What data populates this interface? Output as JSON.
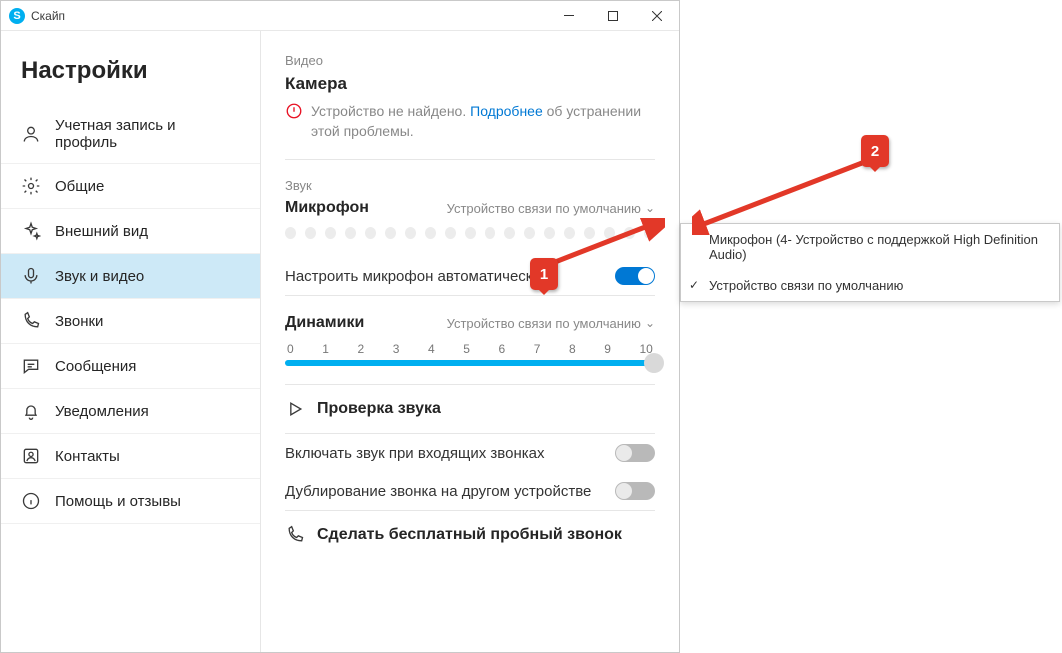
{
  "titlebar": {
    "app_name": "Скайп",
    "app_glyph": "S"
  },
  "sidebar": {
    "title": "Настройки",
    "items": [
      {
        "label": "Учетная запись и профиль"
      },
      {
        "label": "Общие"
      },
      {
        "label": "Внешний вид"
      },
      {
        "label": "Звук и видео"
      },
      {
        "label": "Звонки"
      },
      {
        "label": "Сообщения"
      },
      {
        "label": "Уведомления"
      },
      {
        "label": "Контакты"
      },
      {
        "label": "Помощь и отзывы"
      }
    ]
  },
  "video": {
    "section": "Видео",
    "heading": "Камера",
    "warn_prefix": "Устройство не найдено. ",
    "warn_link": "Подробнее",
    "warn_suffix": " об устранении этой проблемы."
  },
  "audio": {
    "section": "Звук",
    "mic_heading": "Микрофон",
    "mic_device": "Устройство связи по умолчанию",
    "auto_adjust": "Настроить микрофон автоматически",
    "speakers_heading": "Динамики",
    "speakers_device": "Устройство связи по умолчанию",
    "slider_ticks": [
      "0",
      "1",
      "2",
      "3",
      "4",
      "5",
      "6",
      "7",
      "8",
      "9",
      "10"
    ],
    "slider_value": 10,
    "slider_max": 10,
    "test_audio": "Проверка звука",
    "unmute_incoming": "Включать звук при входящих звонках",
    "ring_other": "Дублирование звонка на другом устройстве",
    "free_call": "Сделать бесплатный пробный звонок"
  },
  "dropdown": {
    "options": [
      {
        "label": "Микрофон (4- Устройство с поддержкой High Definition Audio)",
        "checked": false
      },
      {
        "label": "Устройство связи по умолчанию",
        "checked": true
      }
    ]
  },
  "callouts": {
    "one": "1",
    "two": "2"
  }
}
